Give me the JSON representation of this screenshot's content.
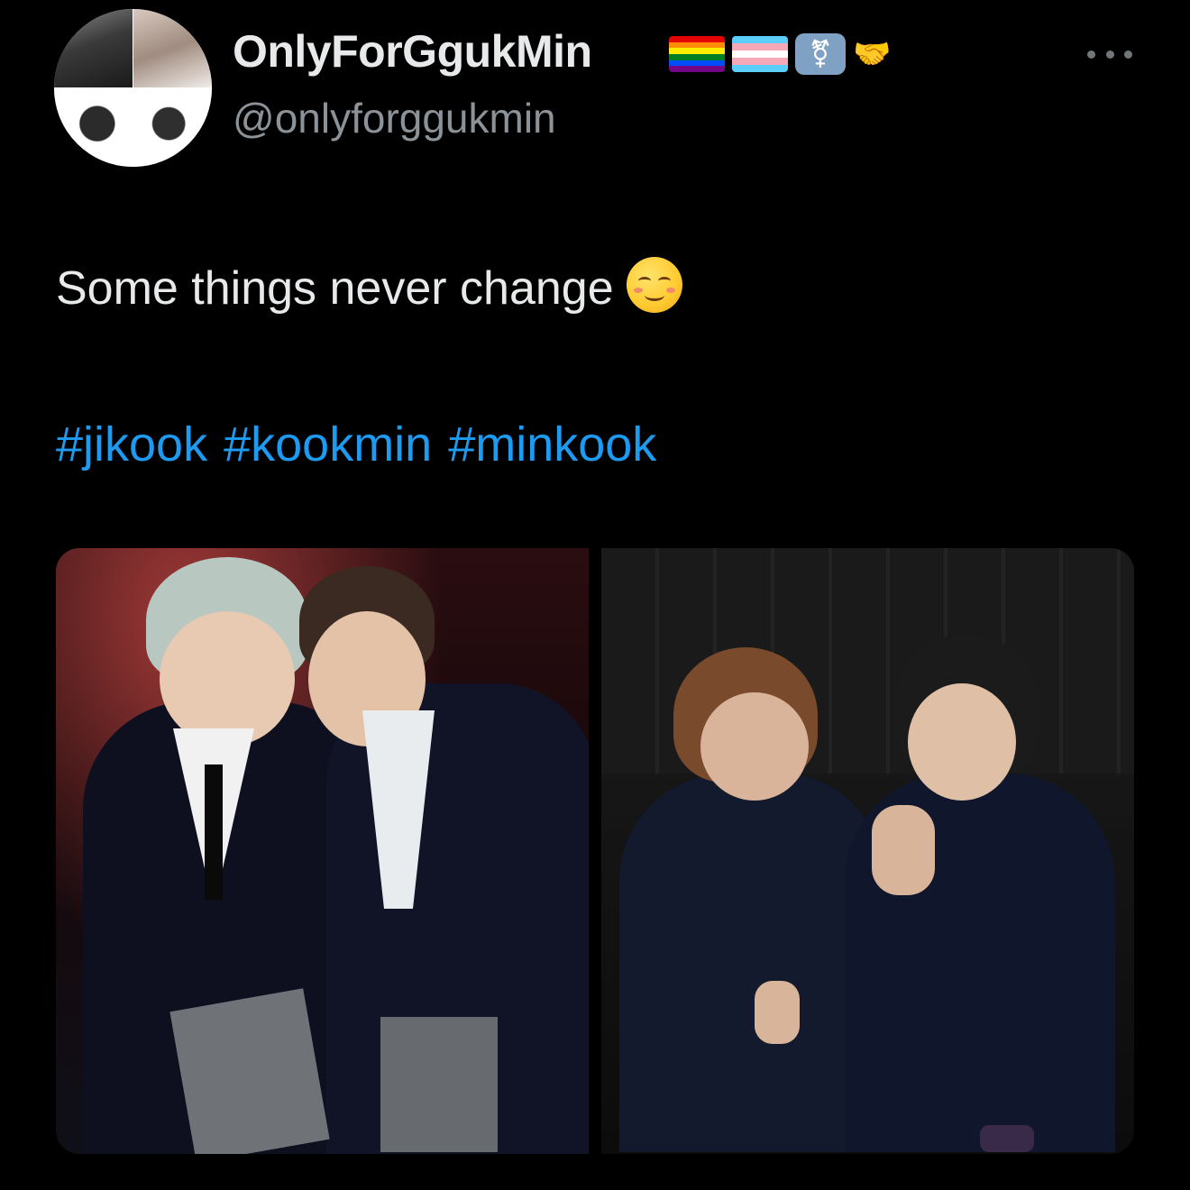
{
  "author": {
    "display_name": "OnlyForGgukMin",
    "handle": "@onlyforggukmin",
    "badges": [
      "rainbow-flag-icon",
      "transgender-flag-icon",
      "transgender-symbol-icon",
      "handshake-icon"
    ]
  },
  "tweet": {
    "text": "Some things never change",
    "emoji": "smiling-face-icon",
    "hashtags": [
      "#jikook",
      "#kookmin",
      "#minkook"
    ]
  },
  "media": {
    "count": 2,
    "items": [
      "photo-1",
      "photo-2"
    ]
  },
  "colors": {
    "background": "#000000",
    "text": "#e7e9ea",
    "secondary": "#8b9298",
    "link": "#1d9bf0"
  }
}
